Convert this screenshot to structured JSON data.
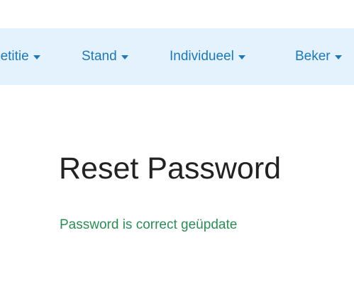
{
  "nav": {
    "items": [
      {
        "label": "petitie"
      },
      {
        "label": "Stand"
      },
      {
        "label": "Individueel"
      },
      {
        "label": "Beker"
      }
    ]
  },
  "main": {
    "title": "Reset Password",
    "status_message": "Password is correct geüpdate"
  },
  "colors": {
    "nav_background": "#e3f2fd",
    "nav_link": "#1f78b4",
    "success_text": "#2e8b57"
  }
}
